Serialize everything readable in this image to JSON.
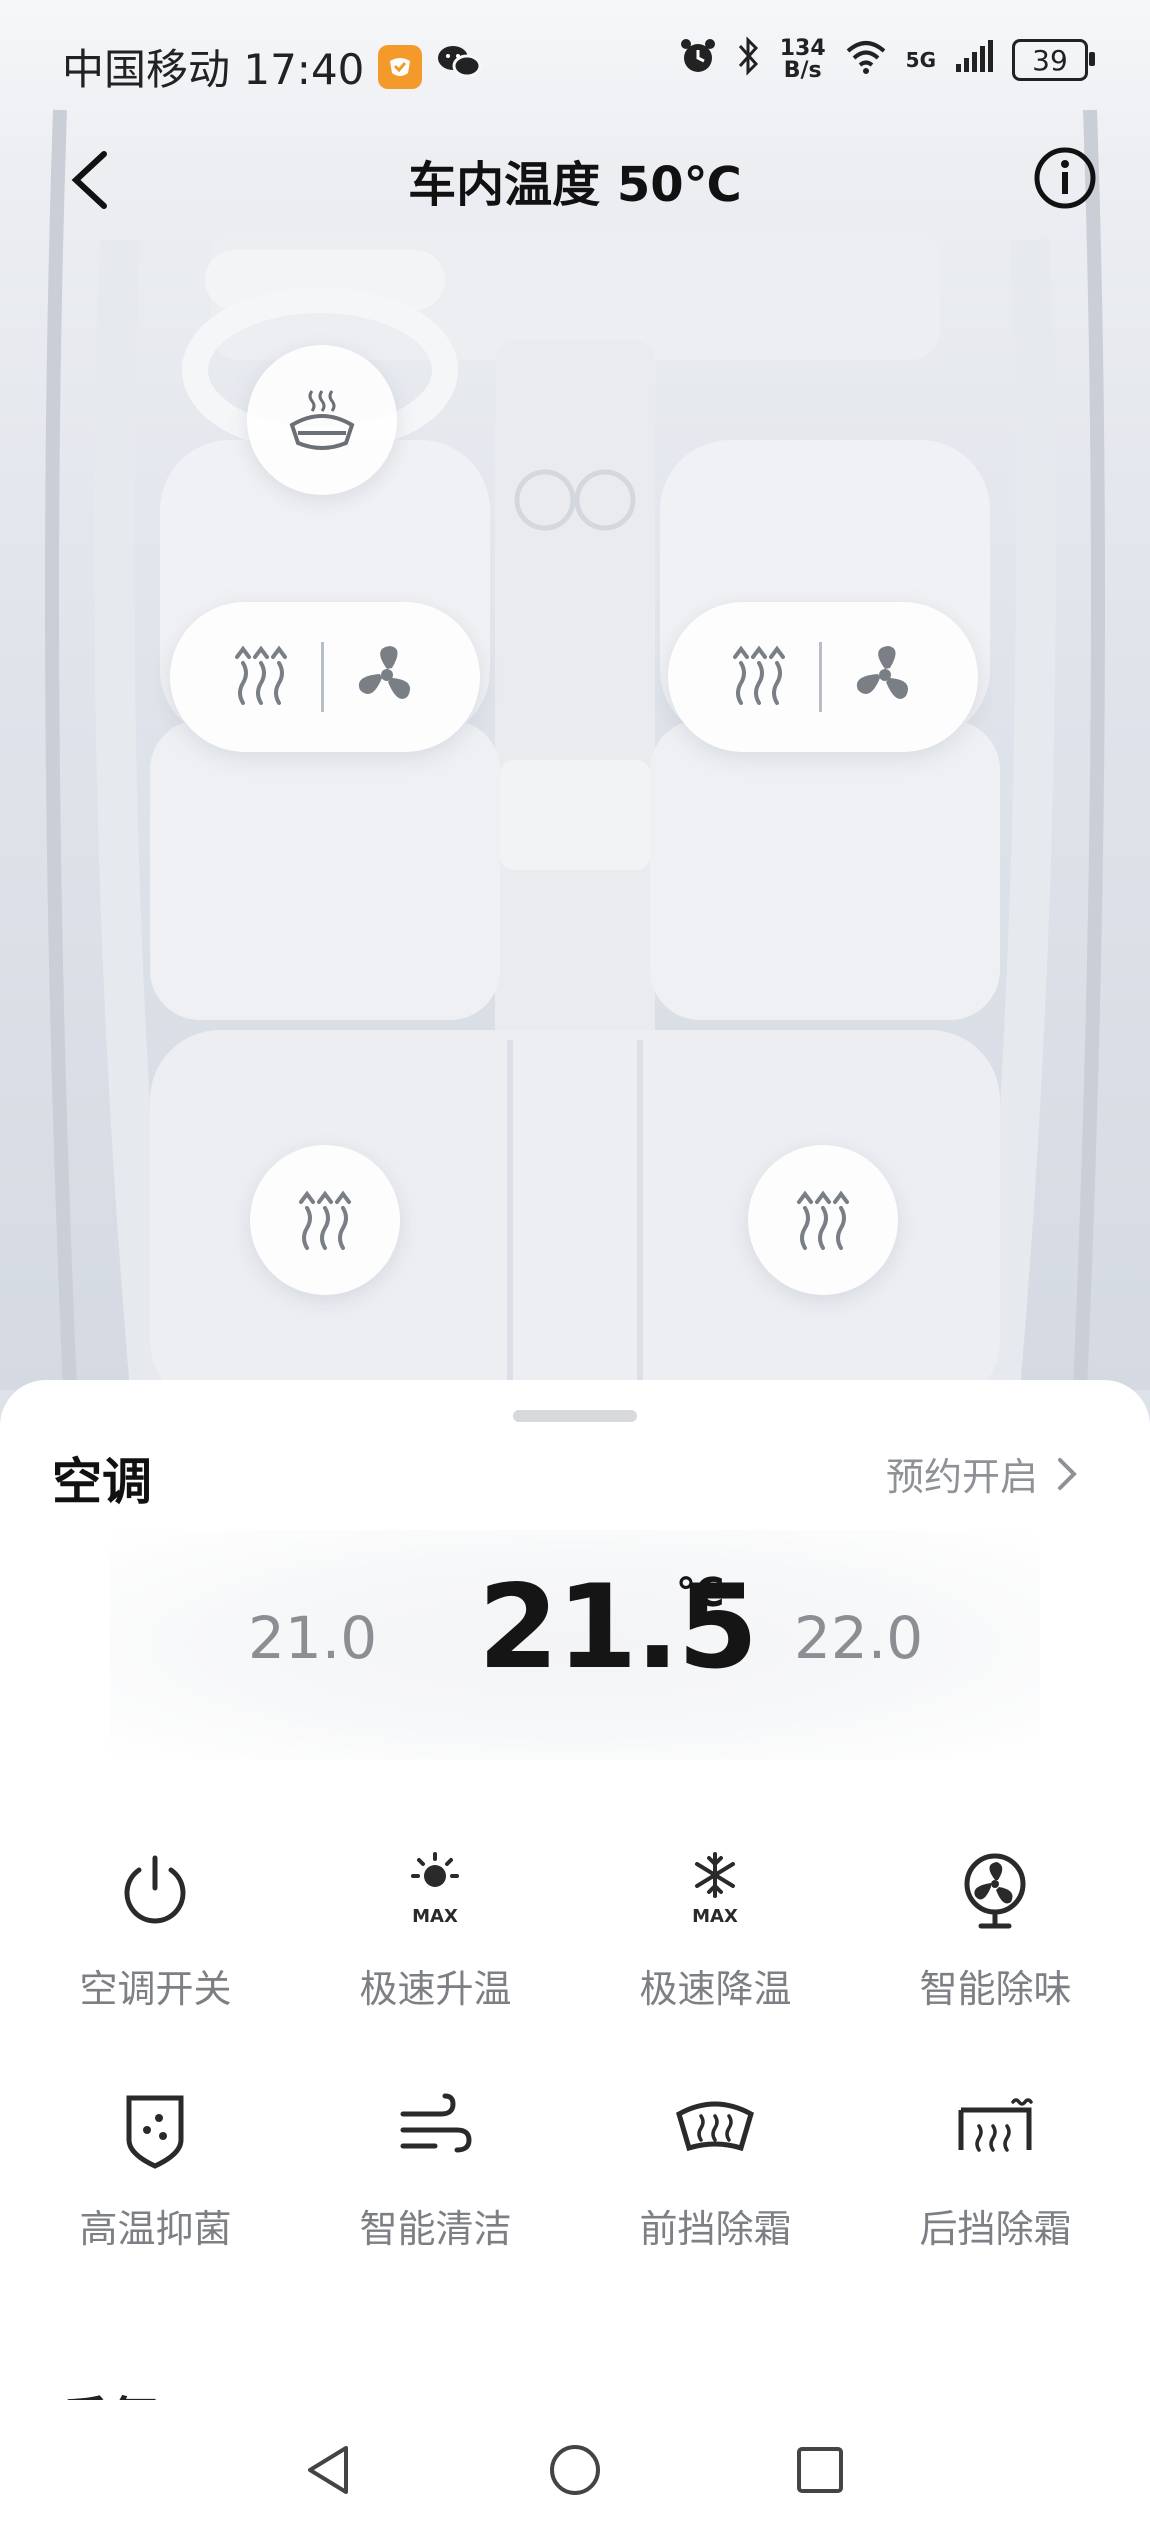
{
  "status_bar": {
    "carrier_time": "中国移动 17:40",
    "net_speed_value": "134",
    "net_speed_unit": "B/s",
    "network": "5G",
    "battery": "39"
  },
  "header": {
    "title": "车内温度 50℃"
  },
  "car_controls": {
    "steering_heat_icon": "steering-wheel-heat-icon",
    "front_left": [
      "seat-heat-icon",
      "seat-ventilation-icon"
    ],
    "front_right": [
      "seat-heat-icon",
      "seat-ventilation-icon"
    ],
    "rear_left": "seat-heat-icon",
    "rear_right": "seat-heat-icon"
  },
  "ac": {
    "title": "空调",
    "schedule_label": "预约开启",
    "temp_lower": "21.0",
    "temp_current": "21.5",
    "temp_unit": "℃",
    "temp_higher": "22.0",
    "functions": [
      {
        "label": "空调开关",
        "icon": "power-icon"
      },
      {
        "label": "极速升温",
        "icon": "sun-max-icon"
      },
      {
        "label": "极速降温",
        "icon": "snowflake-max-icon"
      },
      {
        "label": "智能除味",
        "icon": "fan-icon"
      },
      {
        "label": "高温抑菌",
        "icon": "shield-dots-icon"
      },
      {
        "label": "智能清洁",
        "icon": "wind-icon"
      },
      {
        "label": "前挡除霜",
        "icon": "front-defrost-icon"
      },
      {
        "label": "后挡除霜",
        "icon": "rear-defrost-icon"
      }
    ],
    "next_section": "香氛"
  },
  "colors": {
    "accent_text": "#111111",
    "muted_text": "#7c7f84",
    "icon": "#2a2a2a"
  }
}
